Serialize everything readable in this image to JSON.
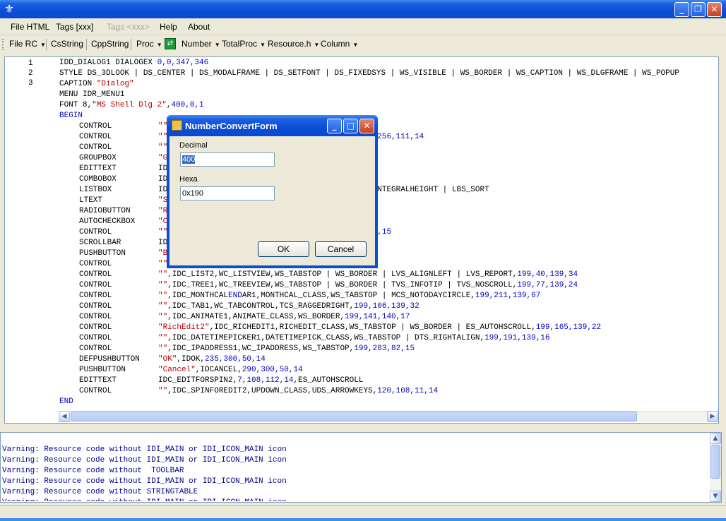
{
  "window": {
    "title": "",
    "app_icon": "fleur-de-lis-icon",
    "controls": {
      "minimize": "_",
      "maximize": "❐",
      "close": "✕"
    }
  },
  "menu": [
    {
      "label": "File HTML",
      "disabled": false
    },
    {
      "label": "Tags [xxx]",
      "disabled": false
    },
    {
      "label": "Tags <xxx>",
      "disabled": true
    },
    {
      "label": "Help",
      "disabled": false
    },
    {
      "label": "About",
      "disabled": false
    }
  ],
  "toolbar": {
    "file_rc": "File RC",
    "csstring": "CsString",
    "cppstring": "CppString",
    "proc": "Proc",
    "number": "Number",
    "totalproc": "TotalProc",
    "resource_h": "Resource.h",
    "column": "Column"
  },
  "editor": {
    "line_numbers": [
      "1",
      "2",
      "3"
    ],
    "lines": [
      {
        "indent": false,
        "kw": "IDD_DIALOG1 DIALOGEX ",
        "rest": [
          {
            "t": "0,0,347,346",
            "c": "num"
          }
        ]
      },
      {
        "indent": false,
        "kw": "STYLE DS_3DLOOK | DS_CENTER | DS_MODALFRAME | DS_SETFONT | DS_FIXEDSYS | WS_VISIBLE | WS_BORDER | WS_CAPTION | WS_DLGFRAME | WS_POPUP",
        "rest": []
      },
      {
        "indent": false,
        "kw": "CAPTION ",
        "rest": [
          {
            "t": "\"Dialog\"",
            "c": "str"
          }
        ]
      },
      {
        "indent": false,
        "kw": "MENU IDR_MENU1",
        "rest": []
      },
      {
        "indent": false,
        "kw": "FONT ",
        "rest": [
          {
            "t": "8,",
            "c": ""
          },
          {
            "t": "\"MS Shell Dlg 2\"",
            "c": "str"
          },
          {
            "t": ",",
            "c": ""
          },
          {
            "t": "400,0,1",
            "c": "num"
          }
        ]
      },
      {
        "indent": false,
        "kw": "BEGIN",
        "rest": [],
        "keyw": true
      },
      {
        "indent": true,
        "kw": "CONTROL",
        "rest": [
          {
            "t": "\"\"",
            "c": "str"
          },
          {
            "t": "                                 ",
            "c": ""
          },
          {
            "t": "111,20",
            "c": "num"
          }
        ]
      },
      {
        "indent": true,
        "kw": "CONTROL",
        "rest": [
          {
            "t": "\"\"",
            "c": "str"
          },
          {
            "t": "                                 S_NOTICKS,",
            "c": ""
          },
          {
            "t": "7,256,111,14",
            "c": "num"
          }
        ]
      },
      {
        "indent": true,
        "kw": "CONTROL",
        "rest": [
          {
            "t": "\"\"",
            "c": "str"
          },
          {
            "t": "                                 ",
            "c": ""
          },
          {
            "t": "12,15",
            "c": "num"
          }
        ]
      },
      {
        "indent": true,
        "kw": "GROUPBOX",
        "rest": [
          {
            "t": "\"G",
            "c": "str"
          }
        ]
      },
      {
        "indent": true,
        "kw": "EDITTEXT",
        "rest": [
          {
            "t": "ID",
            "c": ""
          }
        ]
      },
      {
        "indent": true,
        "kw": "COMBOBOX",
        "rest": [
          {
            "t": "ID                                 ASSTRINGS",
            "c": ""
          }
        ]
      },
      {
        "indent": true,
        "kw": "LISTBOX",
        "rest": [
          {
            "t": "ID                                 LL | LBS_NOINTEGRALHEIGHT | LBS_SORT",
            "c": ""
          }
        ]
      },
      {
        "indent": true,
        "kw": "LTEXT",
        "rest": [
          {
            "t": "\"S",
            "c": "str"
          }
        ]
      },
      {
        "indent": true,
        "kw": "RADIOBUTTON",
        "rest": [
          {
            "t": "\"R",
            "c": "str"
          }
        ]
      },
      {
        "indent": true,
        "kw": "AUTOCHECKBOX",
        "rest": [
          {
            "t": "\"C",
            "c": "str"
          }
        ]
      },
      {
        "indent": true,
        "kw": "CONTROL",
        "rest": [
          {
            "t": "\"\"",
            "c": "str"
          },
          {
            "t": "                                 YS,",
            "c": ""
          },
          {
            "t": "120,91,11,15",
            "c": "num"
          }
        ]
      },
      {
        "indent": true,
        "kw": "SCROLLBAR",
        "rest": [
          {
            "t": "ID",
            "c": ""
          }
        ]
      },
      {
        "indent": true,
        "kw": "PUSHBUTTON",
        "rest": [
          {
            "t": "\"B",
            "c": "str"
          }
        ]
      },
      {
        "indent": true,
        "kw": "CONTROL",
        "rest": [
          {
            "t": "\"\"",
            "c": "str"
          },
          {
            "t": "                                 ",
            "c": ""
          },
          {
            "t": "16",
            "c": "num"
          }
        ]
      },
      {
        "indent": true,
        "kw": "CONTROL",
        "rest": [
          {
            "t": "\"\"",
            "c": "str"
          },
          {
            "t": ",IDC_LIST2,WC_LISTVIEW,WS_TABSTOP | WS_BORDER | LVS_ALIGNLEFT | LVS_REPORT,",
            "c": ""
          },
          {
            "t": "199,40,139,34",
            "c": "num"
          }
        ]
      },
      {
        "indent": true,
        "kw": "CONTROL",
        "rest": [
          {
            "t": "\"\"",
            "c": "str"
          },
          {
            "t": ",IDC_TREE1,WC_TREEVIEW,WS_TABSTOP | WS_BORDER | TVS_INFOTIP | TVS_NOSCROLL,",
            "c": ""
          },
          {
            "t": "199,77,139,24",
            "c": "num"
          }
        ]
      },
      {
        "indent": true,
        "kw": "CONTROL",
        "rest": [
          {
            "t": "\"\"",
            "c": "str"
          },
          {
            "t": ",IDC_MONTHCAL",
            "c": ""
          },
          {
            "t": "END",
            "c": "keyw"
          },
          {
            "t": "AR1,MONTHCAL_CLASS,WS_TABSTOP | MCS_NOTODAYCIRCLE,",
            "c": ""
          },
          {
            "t": "199,211,139,67",
            "c": "num"
          }
        ]
      },
      {
        "indent": true,
        "kw": "CONTROL",
        "rest": [
          {
            "t": "\"\"",
            "c": "str"
          },
          {
            "t": ",IDC_TAB1,WC_TABCONTROL,TCS_RAGGEDRIGHT,",
            "c": ""
          },
          {
            "t": "199,106,139,32",
            "c": "num"
          }
        ]
      },
      {
        "indent": true,
        "kw": "CONTROL",
        "rest": [
          {
            "t": "\"\"",
            "c": "str"
          },
          {
            "t": ",IDC_ANIMATE1,ANIMATE_CLASS,WS_BORDER,",
            "c": ""
          },
          {
            "t": "199,141,140,17",
            "c": "num"
          }
        ]
      },
      {
        "indent": true,
        "kw": "CONTROL",
        "rest": [
          {
            "t": "\"RichEdit2\"",
            "c": "str"
          },
          {
            "t": ",IDC_RICHEDIT1,RICHEDIT_CLASS,WS_TABSTOP | WS_BORDER | ES_AUTOHSCROLL,",
            "c": ""
          },
          {
            "t": "199,165,139,22",
            "c": "num"
          }
        ]
      },
      {
        "indent": true,
        "kw": "CONTROL",
        "rest": [
          {
            "t": "\"\"",
            "c": "str"
          },
          {
            "t": ",IDC_DATETIMEPICKER1,DATETIMEPICK_CLASS,WS_TABSTOP | DTS_RIGHTALIGN,",
            "c": ""
          },
          {
            "t": "199,191,139,16",
            "c": "num"
          }
        ]
      },
      {
        "indent": true,
        "kw": "CONTROL",
        "rest": [
          {
            "t": "\"\"",
            "c": "str"
          },
          {
            "t": ",IDC_IPADDRESS1,WC_IPADDRESS,WS_TABSTOP,",
            "c": ""
          },
          {
            "t": "199,283,82,15",
            "c": "num"
          }
        ]
      },
      {
        "indent": true,
        "kw": "DEFPUSHBUTTON",
        "rest": [
          {
            "t": "\"OK\"",
            "c": "str"
          },
          {
            "t": ",IDOK,",
            "c": ""
          },
          {
            "t": "235,300,50,14",
            "c": "num"
          }
        ]
      },
      {
        "indent": true,
        "kw": "PUSHBUTTON",
        "rest": [
          {
            "t": "\"Cancel\"",
            "c": "str"
          },
          {
            "t": ",IDCANCEL,",
            "c": ""
          },
          {
            "t": "290,300,50,14",
            "c": "num"
          }
        ]
      },
      {
        "indent": true,
        "kw": "EDITTEXT",
        "rest": [
          {
            "t": "IDC_EDITFORSPIN2,",
            "c": ""
          },
          {
            "t": "7,108,112,14",
            "c": "num"
          },
          {
            "t": ",ES_AUTOHSCROLL",
            "c": ""
          }
        ]
      },
      {
        "indent": true,
        "kw": "CONTROL",
        "rest": [
          {
            "t": "\"\"",
            "c": "str"
          },
          {
            "t": ",IDC_SPINFOREDIT2,UPDOWN_CLASS,UDS_ARROWKEYS,",
            "c": ""
          },
          {
            "t": "120,108,11,14",
            "c": "num"
          }
        ]
      },
      {
        "indent": false,
        "kw": "END",
        "rest": [],
        "keyw": true
      }
    ]
  },
  "output": {
    "lines": [
      "Varning: Resource code without IDI_MAIN or IDI_ICON_MAIN icon",
      "Varning: Resource code without IDI_MAIN or IDI_ICON_MAIN icon",
      "Varning: Resource code without  TOOLBAR",
      "Varning: Resource code without IDI_MAIN or IDI_ICON_MAIN icon",
      "Varning: Resource code without STRINGTABLE",
      "Varning: Resource code without IDI_MAIN or IDI_ICON_MAIN icon"
    ]
  },
  "dialog": {
    "title": "NumberConvertForm",
    "decimal_label": "Decimal",
    "decimal_value": "400",
    "hexa_label": "Hexa",
    "hexa_value": "0x190",
    "ok_label": "OK",
    "cancel_label": "Cancel"
  },
  "colors": {
    "string": "#c00000",
    "number": "#0000c0",
    "titlebar": "#0a4ed6"
  }
}
